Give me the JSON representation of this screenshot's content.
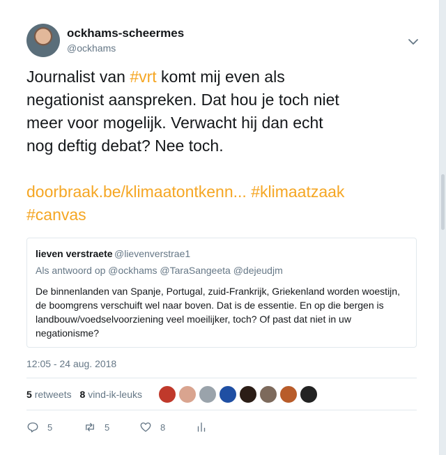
{
  "author": {
    "name": "ockhams-scheermes",
    "handle": "@ockhams"
  },
  "tweet": {
    "line1_pre": "Journalist van ",
    "line1_hashtag": "#vrt",
    "line1_post": " komt mij even als",
    "line2": "negationist aanspreken. Dat hou je toch niet",
    "line3": "meer voor mogelijk. Verwacht hij dan echt",
    "line4": "nog deftig debat? Nee toch.",
    "link": "doorbraak.be/klimaatontkenn...",
    "hashtag_klimaatzaak": "#klimaatzaak",
    "hashtag_canvas": "#canvas",
    "link_color": "#f5a623"
  },
  "quoted": {
    "name": "lieven verstraete",
    "handle": "@lievenverstrae1",
    "reply_prefix": "Als antwoord op",
    "reply_mentions": "@ockhams @TaraSangeeta @dejeudjm",
    "text_line1": "De binnenlanden van Spanje, Portugal, zuid-Frankrijk, Griekenland worden woestijn,",
    "text_line2": "de boomgrens verschuift wel naar boven. Dat is de essentie.  En op die bergen is",
    "text_line3": "landbouw/voedselvoorziening veel moeilijker, toch? Of past dat niet in uw",
    "text_line4": "negationisme?"
  },
  "timestamp": "12:05 - 24 aug. 2018",
  "stats": {
    "retweets_count": "5",
    "retweets_label": "retweets",
    "likes_count": "8",
    "likes_label": "vind-ik-leuks"
  },
  "actions": {
    "reply_count": "5",
    "retweet_count": "5",
    "like_count": "8"
  },
  "likers": [
    {
      "icon": "avatar-flag",
      "color": "#c0392b"
    },
    {
      "icon": "avatar-woman",
      "color": "#d9a48f"
    },
    {
      "icon": "avatar-grey",
      "color": "#9aa3ab"
    },
    {
      "icon": "avatar-free",
      "color": "#1f4fa3"
    },
    {
      "icon": "avatar-dark",
      "color": "#2b1d16"
    },
    {
      "icon": "avatar-person",
      "color": "#7d6a5c"
    },
    {
      "icon": "avatar-clock",
      "color": "#b85c2a"
    },
    {
      "icon": "avatar-black",
      "color": "#222222"
    }
  ]
}
